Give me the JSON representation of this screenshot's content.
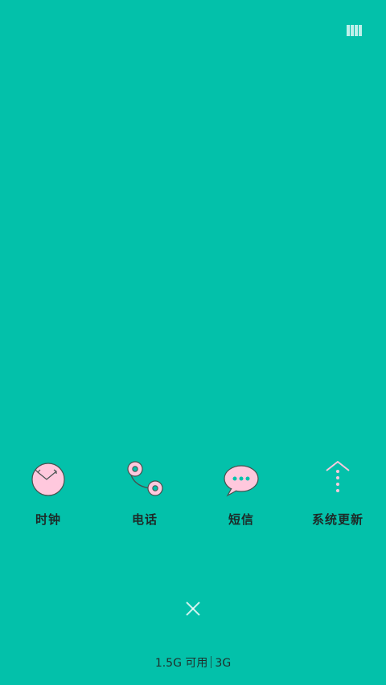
{
  "apps": [
    {
      "label": "时钟",
      "icon": "clock-icon"
    },
    {
      "label": "电话",
      "icon": "phone-icon"
    },
    {
      "label": "短信",
      "icon": "message-icon"
    },
    {
      "label": "系统更新",
      "icon": "system-update-icon"
    }
  ],
  "controls": {
    "multi_window_icon": "multi-window-icon",
    "close_icon": "close-icon"
  },
  "status": {
    "memory_available": "1.5G 可用",
    "network": "3G"
  },
  "colors": {
    "background": "#03c1aa",
    "icon_fill": "#ffc8dd",
    "icon_stroke": "#46504e",
    "control_white": "#ffffff"
  }
}
